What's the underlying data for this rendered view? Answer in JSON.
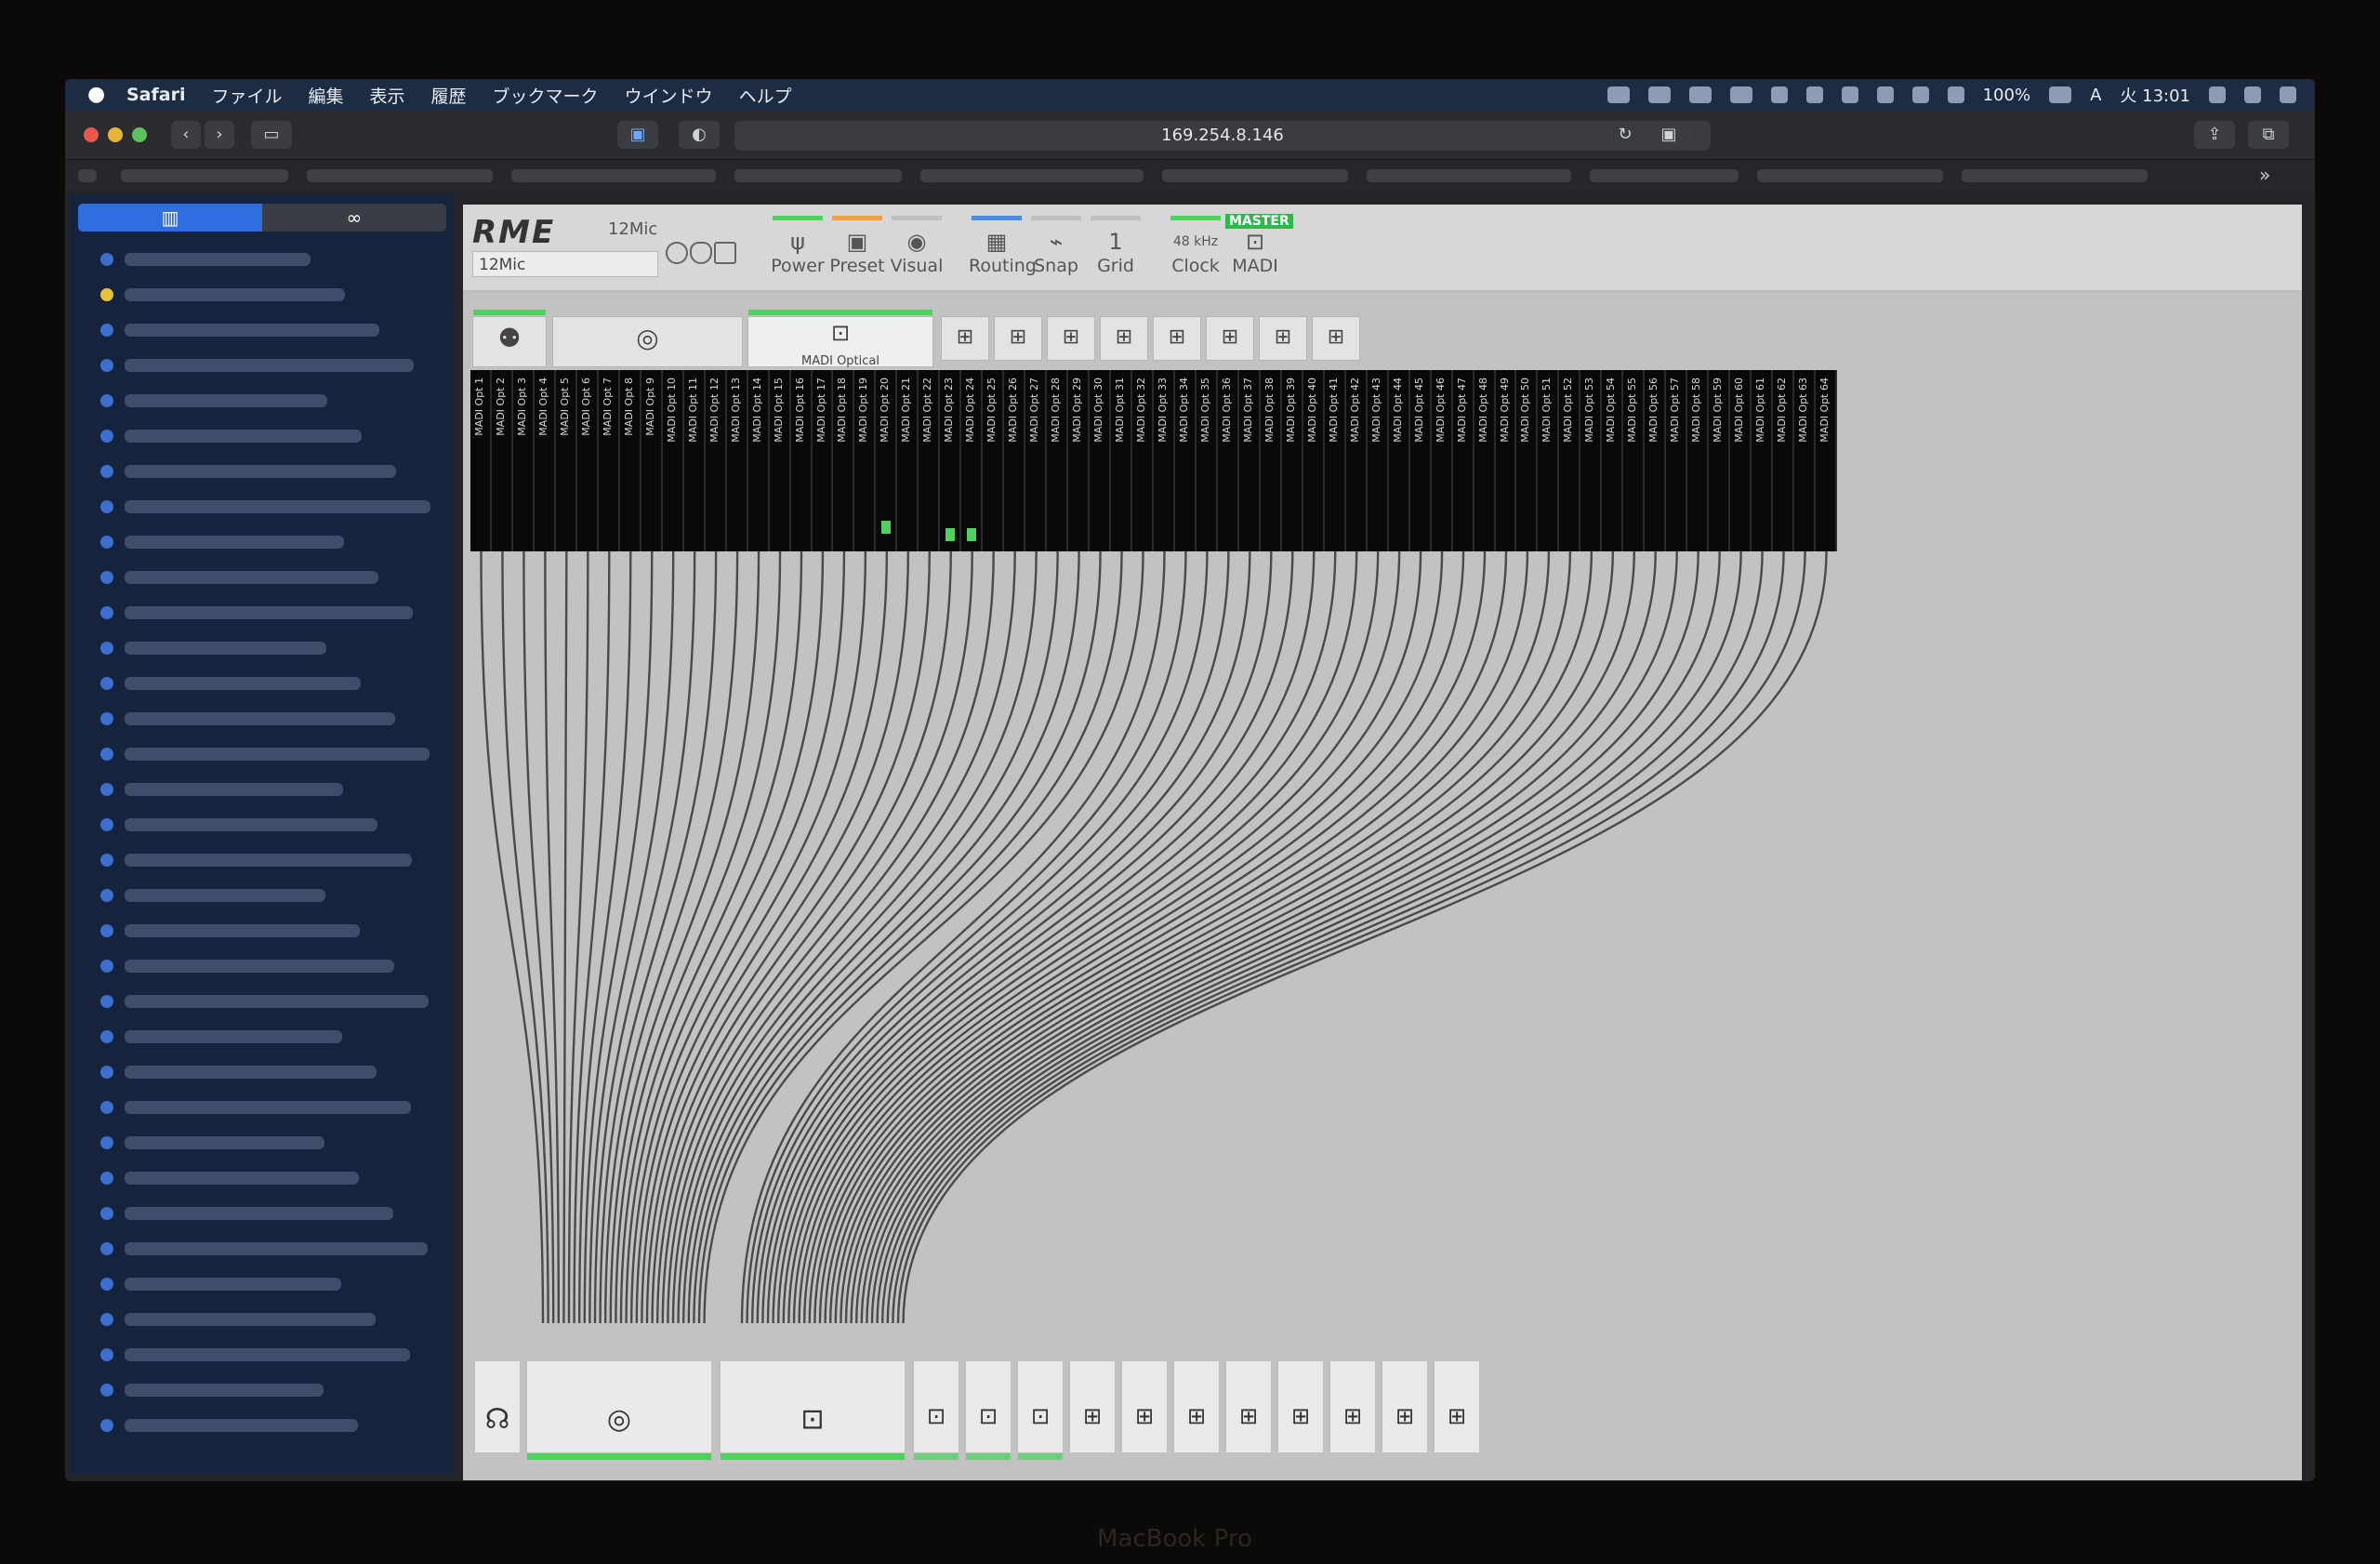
{
  "menubar": {
    "app": "Safari",
    "menus": [
      "ファイル",
      "編集",
      "表示",
      "履歴",
      "ブックマーク",
      "ウインドウ",
      "ヘルプ"
    ],
    "battery": "100%",
    "input_mode": "A",
    "clock": "火 13:01"
  },
  "browser": {
    "url": "169.254.8.146"
  },
  "sidebar": {
    "tab_bookmarks_icon": "book-icon",
    "tab_reading_icon": "glasses-icon"
  },
  "rme": {
    "logo": "RME",
    "model": "12Mic",
    "device_name": "12Mic",
    "toolbar": [
      {
        "label": "Power",
        "glyph": "ψ",
        "color": "#4fd05f"
      },
      {
        "label": "Preset",
        "glyph": "▣",
        "color": "#f0a040"
      },
      {
        "label": "Visual",
        "glyph": "◉",
        "color": "#c0c0c0"
      },
      {
        "label": "Routing",
        "glyph": "▦",
        "color": "#4a8be0"
      },
      {
        "label": "Snap",
        "glyph": "⌁",
        "color": "#c0c0c0"
      },
      {
        "label": "Grid",
        "glyph": "1",
        "color": "#c0c0c0"
      },
      {
        "label": "Clock",
        "glyph": "48 kHz",
        "color": "#4fd05f"
      },
      {
        "label": "MADI",
        "glyph": "⊡",
        "color": "#4fd05f"
      }
    ],
    "master_badge": "MASTER",
    "input_selected_label": "MADI Optical",
    "channels": [
      "MADI Opt 1",
      "MADI Opt 2",
      "MADI Opt 3",
      "MADI Opt 4",
      "MADI Opt 5",
      "MADI Opt 6",
      "MADI Opt 7",
      "MADI Opt 8",
      "MADI Opt 9",
      "MADI Opt 10",
      "MADI Opt 11",
      "MADI Opt 12",
      "MADI Opt 13",
      "MADI Opt 14",
      "MADI Opt 15",
      "MADI Opt 16",
      "MADI Opt 17",
      "MADI Opt 18",
      "MADI Opt 19",
      "MADI Opt 20",
      "MADI Opt 21",
      "MADI Opt 22",
      "MADI Opt 23",
      "MADI Opt 24",
      "MADI Opt 25",
      "MADI Opt 26",
      "MADI Opt 27",
      "MADI Opt 28",
      "MADI Opt 29",
      "MADI Opt 30",
      "MADI Opt 31",
      "MADI Opt 32",
      "MADI Opt 33",
      "MADI Opt 34",
      "MADI Opt 35",
      "MADI Opt 36",
      "MADI Opt 37",
      "MADI Opt 38",
      "MADI Opt 39",
      "MADI Opt 40",
      "MADI Opt 41",
      "MADI Opt 42",
      "MADI Opt 43",
      "MADI Opt 44",
      "MADI Opt 45",
      "MADI Opt 46",
      "MADI Opt 47",
      "MADI Opt 48",
      "MADI Opt 49",
      "MADI Opt 50",
      "MADI Opt 51",
      "MADI Opt 52",
      "MADI Opt 53",
      "MADI Opt 54",
      "MADI Opt 55",
      "MADI Opt 56",
      "MADI Opt 57",
      "MADI Opt 58",
      "MADI Opt 59",
      "MADI Opt 60",
      "MADI Opt 61",
      "MADI Opt 62",
      "MADI Opt 63",
      "MADI Opt 64"
    ]
  },
  "laptop_label": "MacBook Pro"
}
